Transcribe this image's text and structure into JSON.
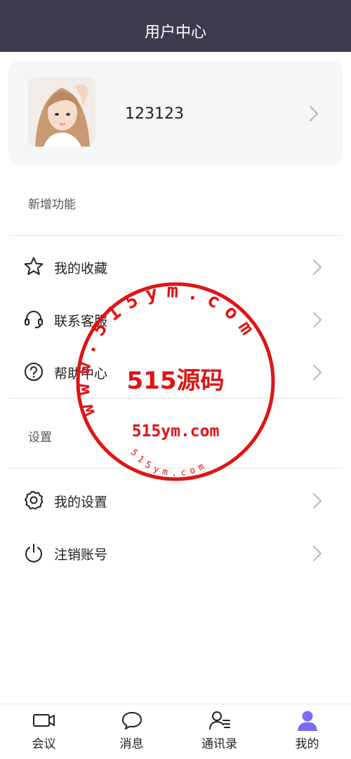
{
  "header": {
    "title": "用户中心"
  },
  "profile": {
    "username": "123123",
    "avatar_icon": "user-avatar-photo",
    "chevron_icon": "chevron-right-icon"
  },
  "sections": {
    "new_features": {
      "label": "新增功能",
      "items": [
        {
          "label": "我的收藏",
          "icon": "star-icon"
        },
        {
          "label": "联系客服",
          "icon": "headset-icon"
        },
        {
          "label": "帮助中心",
          "icon": "help-circle-icon"
        }
      ]
    },
    "settings": {
      "label": "设置",
      "items": [
        {
          "label": "我的设置",
          "icon": "gear-icon"
        },
        {
          "label": "注销账号",
          "icon": "power-icon"
        }
      ]
    }
  },
  "watermark": {
    "title": "515源码",
    "url": "515ym.com",
    "ring_text": "www.515ym.com",
    "inner_text": "515ym.com",
    "color": "#e01414"
  },
  "tabbar": {
    "tabs": [
      {
        "label": "会议",
        "icon": "video-camera-icon",
        "active": false
      },
      {
        "label": "消息",
        "icon": "chat-bubble-icon",
        "active": false
      },
      {
        "label": "通讯录",
        "icon": "contacts-icon",
        "active": false
      },
      {
        "label": "我的",
        "icon": "person-icon",
        "active": true
      }
    ],
    "active_color": "#7b6cf6"
  },
  "colors": {
    "header_bg": "#3c3c4e",
    "card_bg": "#f6f6f7"
  }
}
